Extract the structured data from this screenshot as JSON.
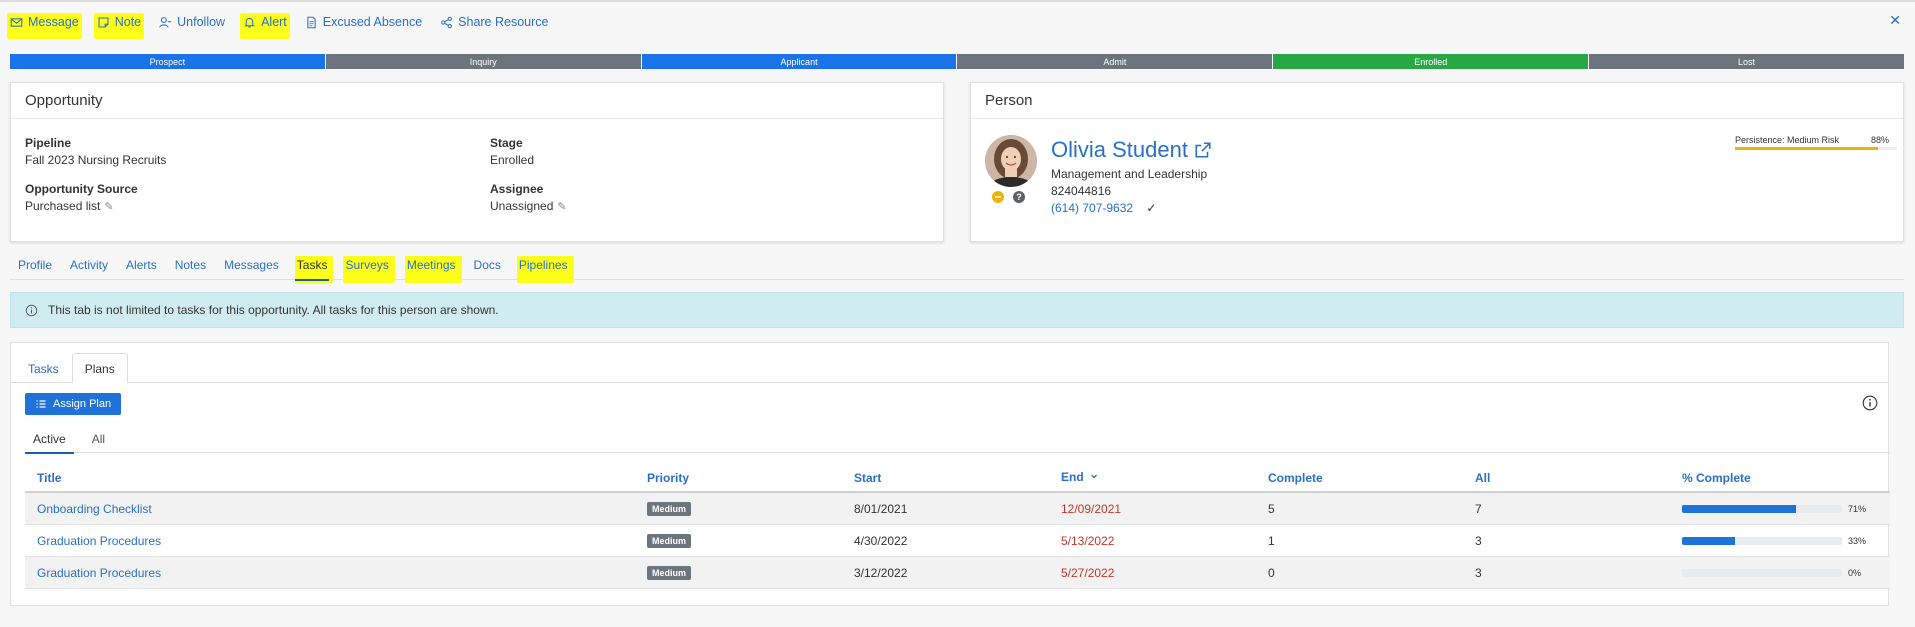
{
  "toolbar": {
    "items": [
      {
        "label": "Message",
        "icon": "envelope-icon",
        "highlighted": true
      },
      {
        "label": "Note",
        "icon": "note-icon",
        "highlighted": true
      },
      {
        "label": "Unfollow",
        "icon": "user-minus-icon",
        "highlighted": false
      },
      {
        "label": "Alert",
        "icon": "bell-icon",
        "highlighted": true
      },
      {
        "label": "Excused Absence",
        "icon": "document-icon",
        "highlighted": false
      },
      {
        "label": "Share Resource",
        "icon": "share-icon",
        "highlighted": false
      }
    ],
    "close": "✕"
  },
  "stages": [
    {
      "label": "Prospect",
      "color": "#1a73e8"
    },
    {
      "label": "Inquiry",
      "color": "#6c757d"
    },
    {
      "label": "Applicant",
      "color": "#1a73e8"
    },
    {
      "label": "Admit",
      "color": "#6c757d"
    },
    {
      "label": "Enrolled",
      "color": "#28a745"
    },
    {
      "label": "Lost",
      "color": "#6c757d"
    }
  ],
  "opportunity": {
    "title": "Opportunity",
    "pipeline_label": "Pipeline",
    "pipeline_value": "Fall 2023 Nursing Recruits",
    "stage_label": "Stage",
    "stage_value": "Enrolled",
    "source_label": "Opportunity Source",
    "source_value": "Purchased list",
    "assignee_label": "Assignee",
    "assignee_value": "Unassigned"
  },
  "person": {
    "title": "Person",
    "name": "Olivia Student",
    "program": "Management and Leadership",
    "id": "824044816",
    "phone": "(614) 707-9632",
    "phone_verified": "✓",
    "persistence_label": "Persistence: Medium Risk",
    "persistence_pct": "88%",
    "persistence_value": 88
  },
  "main_tabs": [
    {
      "label": "Profile",
      "active": false,
      "highlighted": false
    },
    {
      "label": "Activity",
      "active": false,
      "highlighted": false
    },
    {
      "label": "Alerts",
      "active": false,
      "highlighted": false
    },
    {
      "label": "Notes",
      "active": false,
      "highlighted": false
    },
    {
      "label": "Messages",
      "active": false,
      "highlighted": false
    },
    {
      "label": "Tasks",
      "active": true,
      "highlighted": true
    },
    {
      "label": "Surveys",
      "active": false,
      "highlighted": true
    },
    {
      "label": "Meetings",
      "active": false,
      "highlighted": true
    },
    {
      "label": "Docs",
      "active": false,
      "highlighted": false
    },
    {
      "label": "Pipelines",
      "active": false,
      "highlighted": true
    }
  ],
  "banner": {
    "text": "This tab is not limited to tasks for this opportunity. All tasks for this person are shown."
  },
  "sub_tabs": [
    {
      "label": "Tasks",
      "active": false
    },
    {
      "label": "Plans",
      "active": true
    }
  ],
  "assign_plan_label": "Assign Plan",
  "filter_tabs": [
    {
      "label": "Active",
      "active": true
    },
    {
      "label": "All",
      "active": false
    }
  ],
  "table": {
    "columns": [
      "Title",
      "Priority",
      "Start",
      "End",
      "Complete",
      "All",
      "% Complete"
    ],
    "sort_indicator": "⌄",
    "rows": [
      {
        "title": "Onboarding Checklist",
        "priority": "Medium",
        "start": "8/01/2021",
        "end": "12/09/2021",
        "complete": "5",
        "all": "7",
        "pct_label": "71%",
        "pct": 71
      },
      {
        "title": "Graduation Procedures",
        "priority": "Medium",
        "start": "4/30/2022",
        "end": "5/13/2022",
        "complete": "1",
        "all": "3",
        "pct_label": "33%",
        "pct": 33
      },
      {
        "title": "Graduation Procedures",
        "priority": "Medium",
        "start": "3/12/2022",
        "end": "5/27/2022",
        "complete": "0",
        "all": "3",
        "pct_label": "0%",
        "pct": 0
      }
    ]
  },
  "colors": {
    "highlight": "#fbff1a",
    "link": "#2a6fc7",
    "primary": "#1f72d8",
    "banner_bg": "#d1ecf1",
    "overdue": "#c0392b"
  }
}
